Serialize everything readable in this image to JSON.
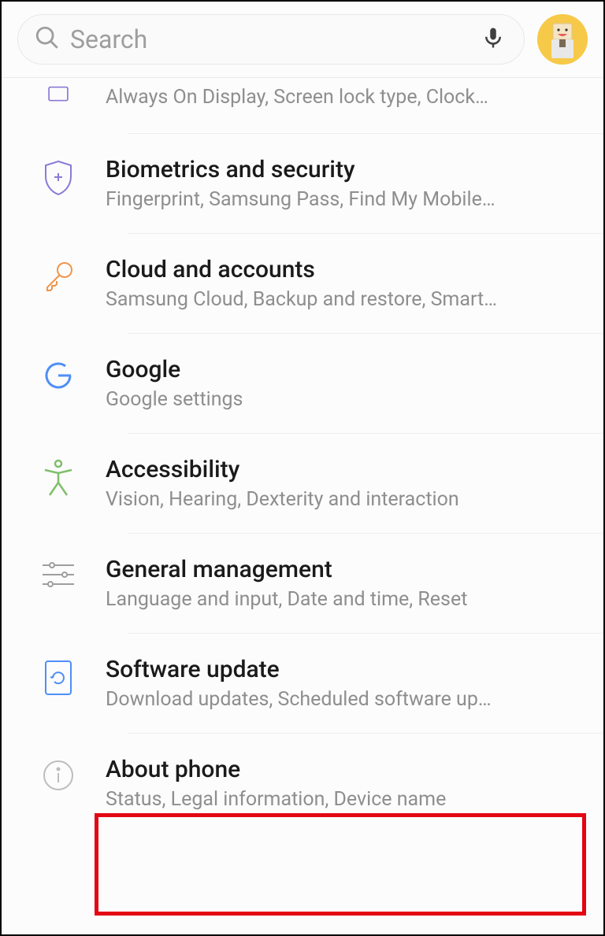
{
  "search": {
    "placeholder": "Search"
  },
  "items": [
    {
      "title": "",
      "sub": "Always On Display, Screen lock type, Clock…"
    },
    {
      "title": "Biometrics and security",
      "sub": "Fingerprint, Samsung Pass, Find My Mobile…"
    },
    {
      "title": "Cloud and accounts",
      "sub": "Samsung Cloud, Backup and restore, Smart…"
    },
    {
      "title": "Google",
      "sub": "Google settings"
    },
    {
      "title": "Accessibility",
      "sub": "Vision, Hearing, Dexterity and interaction"
    },
    {
      "title": "General management",
      "sub": "Language and input, Date and time, Reset"
    },
    {
      "title": "Software update",
      "sub": "Download updates, Scheduled software up…"
    },
    {
      "title": "About phone",
      "sub": "Status, Legal information, Device name"
    }
  ]
}
